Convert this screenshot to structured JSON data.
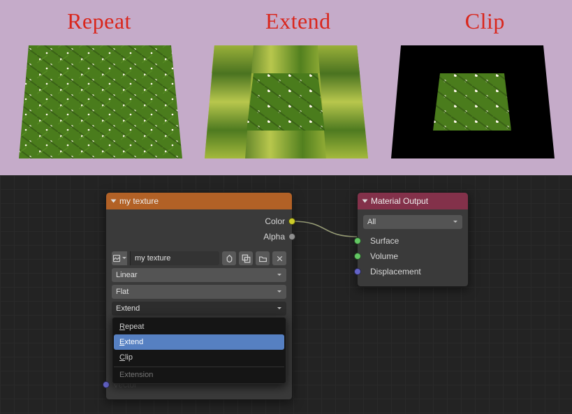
{
  "labels": {
    "repeat": "Repeat",
    "extend": "Extend",
    "clip": "Clip"
  },
  "texture_node": {
    "title": "my texture",
    "out_color": "Color",
    "out_alpha": "Alpha",
    "image_name": "my texture",
    "interp": "Linear",
    "projection": "Flat",
    "extension_selected": "Extend",
    "extension_opts": [
      "Repeat",
      "Extend",
      "Clip"
    ],
    "extension_footer": "Extension",
    "vector": "Vector"
  },
  "output_node": {
    "title": "Material Output",
    "target": "All",
    "in_surface": "Surface",
    "in_volume": "Volume",
    "in_disp": "Displacement"
  }
}
